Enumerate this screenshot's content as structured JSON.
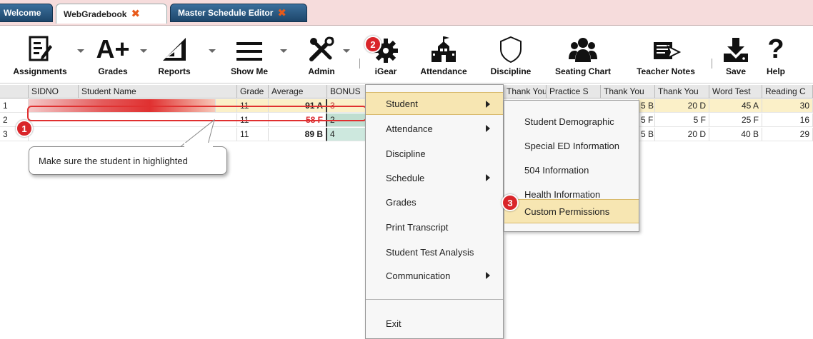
{
  "tabs": [
    {
      "label": "Welcome"
    },
    {
      "label": "WebGradebook"
    },
    {
      "label": "Master Schedule Editor"
    }
  ],
  "toolbar": {
    "assignments": "Assignments",
    "grades": "Grades",
    "reports": "Reports",
    "show_me": "Show Me",
    "admin": "Admin",
    "igear": "iGear",
    "attendance": "Attendance",
    "discipline": "Discipline",
    "seating_chart": "Seating Chart",
    "teacher_notes": "Teacher Notes",
    "save": "Save",
    "help": "Help",
    "grades_icon_text": "A+",
    "help_icon_text": "?"
  },
  "table": {
    "headers": {
      "sidno": "SIDNO",
      "student_name": "Student Name",
      "grade": "Grade",
      "average": "Average",
      "bonus": "BONUS",
      "thank_you_1": "Thank You",
      "practice": "Practice S",
      "thank_you_2": "Thank You",
      "thank_you_3": "Thank You",
      "word_test": "Word Test",
      "reading": "Reading C"
    },
    "rows": [
      {
        "num": "1",
        "grade": "11",
        "average": "91 A",
        "bonus": "3",
        "c1": "5 B",
        "c2": "20 D",
        "c3": "45 A",
        "c4": "30"
      },
      {
        "num": "2",
        "grade": "11",
        "average": "58 F",
        "bonus": "2",
        "c1": "5 F",
        "c2": "5 F",
        "c3": "25 F",
        "c4": "16"
      },
      {
        "num": "3",
        "grade": "11",
        "average": "89 B",
        "bonus": "4",
        "c1": "5 B",
        "c2": "20 D",
        "c3": "40 B",
        "c4": "29"
      }
    ]
  },
  "menu": {
    "items": [
      {
        "label": "Student"
      },
      {
        "label": "Attendance"
      },
      {
        "label": "Discipline"
      },
      {
        "label": "Schedule"
      },
      {
        "label": "Grades"
      },
      {
        "label": "Print Transcript"
      },
      {
        "label": "Student Test Analysis"
      },
      {
        "label": "Communication"
      },
      {
        "label": "Exit"
      }
    ]
  },
  "submenu": {
    "items": [
      {
        "label": "Student Demographic"
      },
      {
        "label": "Special ED Information"
      },
      {
        "label": "504 Information"
      },
      {
        "label": "Health Information"
      },
      {
        "label": "Custom Permissions"
      }
    ]
  },
  "annotations": {
    "badge1": "1",
    "badge2": "2",
    "badge3": "3",
    "callout": "Make sure the student in highlighted"
  },
  "colors": {
    "badge": "#d9252a",
    "menu_highlight": "#f7e6b2",
    "row_highlight": "#fbf0c8",
    "failing": "#d9252a",
    "tab_close": "#e85a1a"
  }
}
